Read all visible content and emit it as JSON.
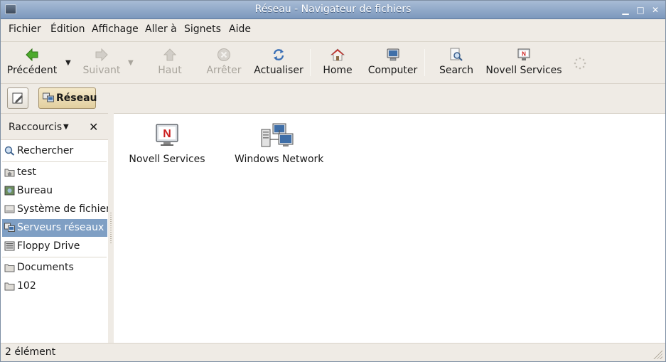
{
  "window": {
    "title": "Réseau - Navigateur de fichiers",
    "controls": {
      "minimize": "▁",
      "maximize": "□",
      "close": "✕"
    }
  },
  "menubar": {
    "items": [
      {
        "label": "Fichier",
        "mnemonic": "F"
      },
      {
        "label": "Édition",
        "mnemonic": "É"
      },
      {
        "label": "Affichage",
        "mnemonic": "A"
      },
      {
        "label": "Aller à",
        "mnemonic": "A"
      },
      {
        "label": "Signets",
        "mnemonic": "S"
      },
      {
        "label": "Aide",
        "mnemonic": "A"
      }
    ]
  },
  "toolbar": {
    "back": {
      "label": "Précédent",
      "icon": "back-arrow-icon",
      "enabled": true
    },
    "forward": {
      "label": "Suivant",
      "icon": "forward-arrow-icon",
      "enabled": false
    },
    "up": {
      "label": "Haut",
      "icon": "up-arrow-icon",
      "enabled": false
    },
    "stop": {
      "label": "Arrêter",
      "icon": "stop-icon",
      "enabled": false
    },
    "reload": {
      "label": "Actualiser",
      "icon": "reload-icon",
      "enabled": true
    },
    "home": {
      "label": "Home",
      "icon": "home-icon"
    },
    "computer": {
      "label": "Computer",
      "icon": "computer-icon"
    },
    "search": {
      "label": "Search",
      "icon": "search-icon"
    },
    "novell": {
      "label": "Novell Services",
      "icon": "novell-icon"
    },
    "throbber": "spinner-icon"
  },
  "location": {
    "current": "Réseau"
  },
  "sidebar": {
    "header_label": "Raccourcis",
    "items": [
      {
        "label": "Rechercher",
        "icon": "search-icon"
      },
      {
        "label": "test",
        "icon": "home-folder-icon"
      },
      {
        "label": "Bureau",
        "icon": "desktop-icon"
      },
      {
        "label": "Système de fichiers",
        "icon": "drive-icon"
      },
      {
        "label": "Serveurs réseaux",
        "icon": "network-icon",
        "selected": true
      },
      {
        "label": "Floppy Drive",
        "icon": "floppy-icon"
      },
      {
        "label": "Documents",
        "icon": "folder-icon"
      },
      {
        "label": "102",
        "icon": "folder-icon"
      }
    ]
  },
  "content": {
    "items": [
      {
        "label": "Novell Services",
        "icon": "novell-monitor-icon"
      },
      {
        "label": "Windows Network",
        "icon": "windows-network-icon"
      }
    ]
  },
  "status": {
    "text": "2 élément"
  },
  "colors": {
    "titlebar": "#7c98bd",
    "selection": "#7f9fc4",
    "chrome": "#efebe5",
    "novell_red": "#cc1f1f"
  }
}
